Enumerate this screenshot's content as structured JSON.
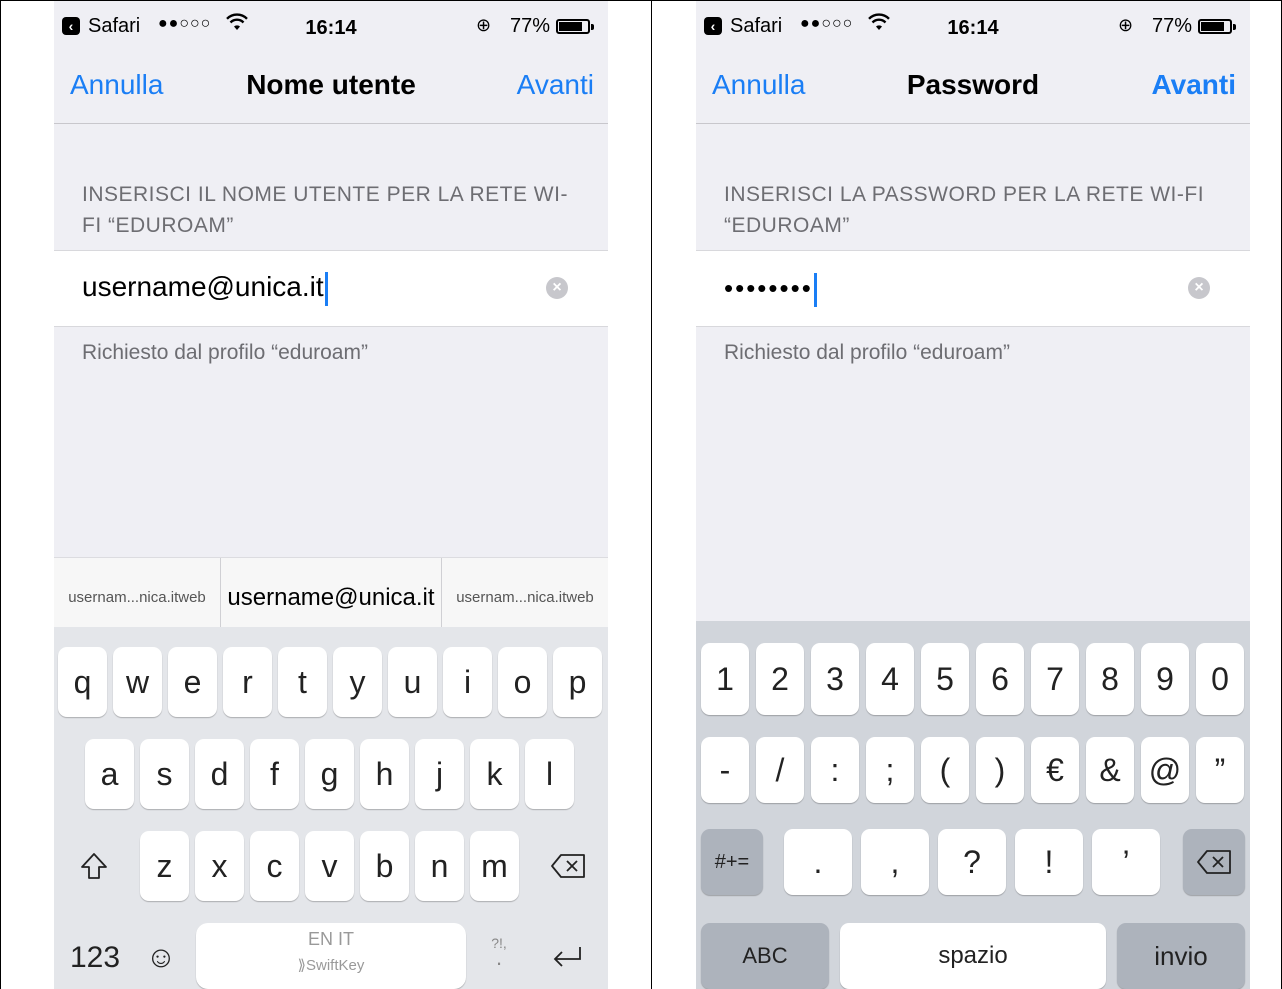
{
  "left": {
    "status": {
      "app": "Safari",
      "signal": "●●○○○",
      "time": "16:14",
      "battery": "77%"
    },
    "nav": {
      "cancel": "Annulla",
      "title": "Nome utente",
      "next": "Avanti"
    },
    "section_header": "INSERISCI IL NOME UTENTE PER LA RETE WI-FI “EDUROAM”",
    "field_value": "username@unica.it",
    "footer": "Richiesto dal profilo “eduroam”",
    "suggestions": [
      "usernam...nica.itweb",
      "username@unica.it",
      "usernam...nica.itweb"
    ],
    "keys_row1": [
      "q",
      "w",
      "e",
      "r",
      "t",
      "y",
      "u",
      "i",
      "o",
      "p"
    ],
    "keys_row2": [
      "a",
      "s",
      "d",
      "f",
      "g",
      "h",
      "j",
      "k",
      "l"
    ],
    "keys_row3": [
      "z",
      "x",
      "c",
      "v",
      "b",
      "n",
      "m"
    ],
    "numbers_key": "123",
    "space_lang": "EN IT",
    "space_brand": "SwiftKey",
    "punct_key": "?!,"
  },
  "right": {
    "status": {
      "app": "Safari",
      "signal": "●●○○○",
      "time": "16:14",
      "battery": "77%"
    },
    "nav": {
      "cancel": "Annulla",
      "title": "Password",
      "next": "Avanti"
    },
    "section_header": "INSERISCI LA PASSWORD PER LA RETE WI-FI “EDUROAM”",
    "field_value": "••••••••",
    "footer": "Richiesto dal profilo “eduroam”",
    "keys_row1": [
      "1",
      "2",
      "3",
      "4",
      "5",
      "6",
      "7",
      "8",
      "9",
      "0"
    ],
    "keys_row2": [
      "-",
      "/",
      ":",
      ";",
      "(",
      ")",
      "€",
      "&",
      "@",
      "”"
    ],
    "keys_row3": [
      ".",
      ",",
      "?",
      "!",
      "’"
    ],
    "symbols_key": "#+=",
    "abc_key": "ABC",
    "space_key": "spazio",
    "return_key": "invio"
  }
}
